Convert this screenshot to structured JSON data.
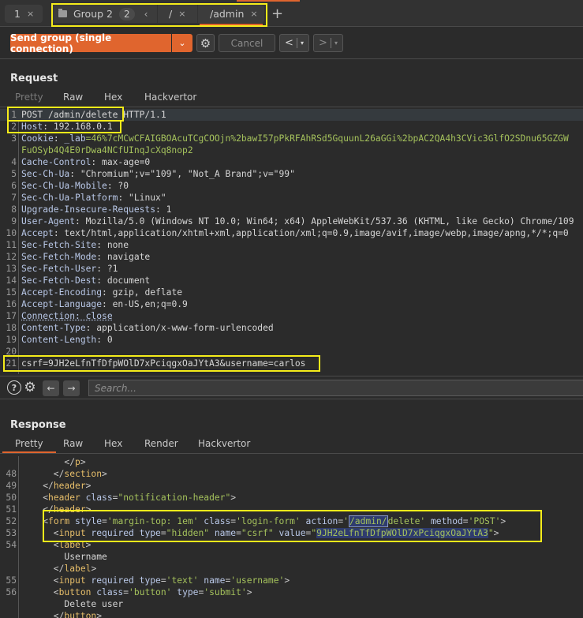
{
  "tabs": {
    "tab1": {
      "label": "1",
      "close": "×"
    },
    "group": {
      "label": "Group 2",
      "count": "2",
      "collapse": "‹"
    },
    "slash": {
      "label": "/",
      "close": "×"
    },
    "admin": {
      "label": "/admin",
      "close": "×"
    },
    "add": "+"
  },
  "toolbar": {
    "send_label": "Send group (single connection)",
    "send_dropdown": "⌄",
    "settings_icon": "⚙",
    "cancel_label": "Cancel",
    "back": "<",
    "forward": ">",
    "dropdown": "▾"
  },
  "request": {
    "title": "Request",
    "tabs": [
      "Pretty",
      "Raw",
      "Hex",
      "Hackvertor"
    ],
    "lines": [
      {
        "n": "1",
        "parts": [
          {
            "t": "POST /admin/delete HTTP/1.1",
            "c": "hval"
          }
        ]
      },
      {
        "n": "2",
        "parts": [
          {
            "t": "Host",
            "c": "hname"
          },
          {
            "t": ": 192.168.0.1",
            "c": "hval"
          }
        ]
      },
      {
        "n": "3",
        "parts": [
          {
            "t": "Cookie",
            "c": "hname"
          },
          {
            "t": ": ",
            "c": "hval"
          },
          {
            "t": "_lab",
            "c": "hname"
          },
          {
            "t": "=46%7cMCwCFAIGBOAcuTCgCOOjn%2bawI57pPkRFAhRSd5GquunL26aGGi%2bpAC2QA4h3CVic3GlfO2SDnu65GZGW",
            "c": "green"
          }
        ]
      },
      {
        "n": "",
        "parts": [
          {
            "t": "FuOSyb4Q4E0rDwa4NCfUInqJcXq8nop2",
            "c": "green"
          }
        ]
      },
      {
        "n": "4",
        "parts": [
          {
            "t": "Cache-Control",
            "c": "hname"
          },
          {
            "t": ": max-age=0",
            "c": "hval"
          }
        ]
      },
      {
        "n": "5",
        "parts": [
          {
            "t": "Sec-Ch-Ua",
            "c": "hname"
          },
          {
            "t": ": \"Chromium\";v=\"109\", \"Not_A Brand\";v=\"99\"",
            "c": "hval"
          }
        ]
      },
      {
        "n": "6",
        "parts": [
          {
            "t": "Sec-Ch-Ua-Mobile",
            "c": "hname"
          },
          {
            "t": ": ?0",
            "c": "hval"
          }
        ]
      },
      {
        "n": "7",
        "parts": [
          {
            "t": "Sec-Ch-Ua-Platform",
            "c": "hname"
          },
          {
            "t": ": \"Linux\"",
            "c": "hval"
          }
        ]
      },
      {
        "n": "8",
        "parts": [
          {
            "t": "Upgrade-Insecure-Requests",
            "c": "hname"
          },
          {
            "t": ": 1",
            "c": "hval"
          }
        ]
      },
      {
        "n": "9",
        "parts": [
          {
            "t": "User-Agent",
            "c": "hname"
          },
          {
            "t": ": Mozilla/5.0 (Windows NT 10.0; Win64; x64) AppleWebKit/537.36 (KHTML, like Gecko) Chrome/109",
            "c": "hval"
          }
        ]
      },
      {
        "n": "10",
        "parts": [
          {
            "t": "Accept",
            "c": "hname"
          },
          {
            "t": ": text/html,application/xhtml+xml,application/xml;q=0.9,image/avif,image/webp,image/apng,*/*;q=0",
            "c": "hval"
          }
        ]
      },
      {
        "n": "11",
        "parts": [
          {
            "t": "Sec-Fetch-Site",
            "c": "hname"
          },
          {
            "t": ": none",
            "c": "hval"
          }
        ]
      },
      {
        "n": "12",
        "parts": [
          {
            "t": "Sec-Fetch-Mode",
            "c": "hname"
          },
          {
            "t": ": navigate",
            "c": "hval"
          }
        ]
      },
      {
        "n": "13",
        "parts": [
          {
            "t": "Sec-Fetch-User",
            "c": "hname"
          },
          {
            "t": ": ?1",
            "c": "hval"
          }
        ]
      },
      {
        "n": "14",
        "parts": [
          {
            "t": "Sec-Fetch-Dest",
            "c": "hname"
          },
          {
            "t": ": document",
            "c": "hval"
          }
        ]
      },
      {
        "n": "15",
        "parts": [
          {
            "t": "Accept-Encoding",
            "c": "hname"
          },
          {
            "t": ": gzip, deflate",
            "c": "hval"
          }
        ]
      },
      {
        "n": "16",
        "parts": [
          {
            "t": "Accept-Language",
            "c": "hname"
          },
          {
            "t": ": en-US,en;q=0.9",
            "c": "hval"
          }
        ]
      },
      {
        "n": "17",
        "parts": [
          {
            "t": "Connection: close",
            "c": "hname dotted"
          }
        ]
      },
      {
        "n": "18",
        "parts": [
          {
            "t": "Content-Type",
            "c": "hname"
          },
          {
            "t": ": application/x-www-form-urlencoded",
            "c": "hval"
          }
        ]
      },
      {
        "n": "19",
        "parts": [
          {
            "t": "Content-Length",
            "c": "hname"
          },
          {
            "t": ": 0",
            "c": "hval"
          }
        ]
      },
      {
        "n": "20",
        "parts": []
      },
      {
        "n": "21",
        "parts": [
          {
            "t": "csrf=9JH2eLfnTfDfpWOlD7xPciqgxOaJYtA3&username=carlos",
            "c": "hval"
          }
        ]
      }
    ]
  },
  "search": {
    "help_icon": "?",
    "settings_icon": "⚙",
    "prev": "←",
    "next": "→",
    "placeholder": "Search..."
  },
  "response": {
    "title": "Response",
    "tabs": [
      "Pretty",
      "Raw",
      "Hex",
      "Render",
      "Hackvertor"
    ],
    "lines": [
      {
        "n": "",
        "parts": [
          {
            "t": "        </",
            "c": "punct"
          },
          {
            "t": "p",
            "c": "tag"
          },
          {
            "t": ">",
            "c": "punct"
          }
        ]
      },
      {
        "n": "48",
        "parts": [
          {
            "t": "      </",
            "c": "punct"
          },
          {
            "t": "section",
            "c": "tag"
          },
          {
            "t": ">",
            "c": "punct"
          }
        ]
      },
      {
        "n": "49",
        "parts": [
          {
            "t": "    </",
            "c": "punct"
          },
          {
            "t": "header",
            "c": "tag"
          },
          {
            "t": ">",
            "c": "punct"
          }
        ]
      },
      {
        "n": "50",
        "parts": [
          {
            "t": "    <",
            "c": "punct"
          },
          {
            "t": "header",
            "c": "tag"
          },
          {
            "t": " class",
            "c": "attr"
          },
          {
            "t": "=",
            "c": "punct"
          },
          {
            "t": "\"notification-header\"",
            "c": "str"
          },
          {
            "t": ">",
            "c": "punct"
          }
        ]
      },
      {
        "n": "51",
        "parts": [
          {
            "t": "    </",
            "c": "punct"
          },
          {
            "t": "header",
            "c": "tag"
          },
          {
            "t": ">",
            "c": "punct"
          }
        ]
      },
      {
        "n": "52",
        "parts": [
          {
            "t": "    <",
            "c": "punct"
          },
          {
            "t": "form",
            "c": "tag"
          },
          {
            "t": " style",
            "c": "attr"
          },
          {
            "t": "=",
            "c": "punct"
          },
          {
            "t": "'margin-top: 1em'",
            "c": "str"
          },
          {
            "t": " class",
            "c": "attr"
          },
          {
            "t": "=",
            "c": "punct"
          },
          {
            "t": "'login-form'",
            "c": "str"
          },
          {
            "t": " action",
            "c": "attr"
          },
          {
            "t": "=",
            "c": "punct"
          },
          {
            "t": "'",
            "c": "str"
          },
          {
            "t": "/admin/",
            "c": "str sel sel-box"
          },
          {
            "t": "delete'",
            "c": "str"
          },
          {
            "t": " method",
            "c": "attr"
          },
          {
            "t": "=",
            "c": "punct"
          },
          {
            "t": "'POST'",
            "c": "str"
          },
          {
            "t": ">",
            "c": "punct"
          }
        ]
      },
      {
        "n": "53",
        "parts": [
          {
            "t": "      <",
            "c": "punct"
          },
          {
            "t": "input",
            "c": "tag"
          },
          {
            "t": " required type",
            "c": "attr"
          },
          {
            "t": "=",
            "c": "punct"
          },
          {
            "t": "\"hidden\"",
            "c": "str"
          },
          {
            "t": " name",
            "c": "attr"
          },
          {
            "t": "=",
            "c": "punct"
          },
          {
            "t": "\"csrf\"",
            "c": "str"
          },
          {
            "t": " value",
            "c": "attr"
          },
          {
            "t": "=",
            "c": "punct"
          },
          {
            "t": "\"",
            "c": "str"
          },
          {
            "t": "9JH2eLfnTfDfpWOlD7xPciqgxOaJYtA3",
            "c": "str sel"
          },
          {
            "t": "\"",
            "c": "str"
          },
          {
            "t": ">",
            "c": "punct"
          }
        ]
      },
      {
        "n": "54",
        "parts": [
          {
            "t": "      <",
            "c": "punct"
          },
          {
            "t": "label",
            "c": "tag"
          },
          {
            "t": ">",
            "c": "punct"
          }
        ]
      },
      {
        "n": "",
        "parts": [
          {
            "t": "        Username",
            "c": "hval"
          }
        ]
      },
      {
        "n": "",
        "parts": [
          {
            "t": "      </",
            "c": "punct"
          },
          {
            "t": "label",
            "c": "tag"
          },
          {
            "t": ">",
            "c": "punct"
          }
        ]
      },
      {
        "n": "55",
        "parts": [
          {
            "t": "      <",
            "c": "punct"
          },
          {
            "t": "input",
            "c": "tag"
          },
          {
            "t": " required type",
            "c": "attr"
          },
          {
            "t": "=",
            "c": "punct"
          },
          {
            "t": "'text'",
            "c": "str"
          },
          {
            "t": " name",
            "c": "attr"
          },
          {
            "t": "=",
            "c": "punct"
          },
          {
            "t": "'username'",
            "c": "str"
          },
          {
            "t": ">",
            "c": "punct"
          }
        ]
      },
      {
        "n": "56",
        "parts": [
          {
            "t": "      <",
            "c": "punct"
          },
          {
            "t": "button",
            "c": "tag"
          },
          {
            "t": " class",
            "c": "attr"
          },
          {
            "t": "=",
            "c": "punct"
          },
          {
            "t": "'button'",
            "c": "str"
          },
          {
            "t": " type",
            "c": "attr"
          },
          {
            "t": "=",
            "c": "punct"
          },
          {
            "t": "'submit'",
            "c": "str"
          },
          {
            "t": ">",
            "c": "punct"
          }
        ]
      },
      {
        "n": "",
        "parts": [
          {
            "t": "        Delete user",
            "c": "hval"
          }
        ]
      },
      {
        "n": "",
        "parts": [
          {
            "t": "      </",
            "c": "punct"
          },
          {
            "t": "button",
            "c": "tag"
          },
          {
            "t": ">",
            "c": "punct"
          }
        ]
      }
    ]
  }
}
